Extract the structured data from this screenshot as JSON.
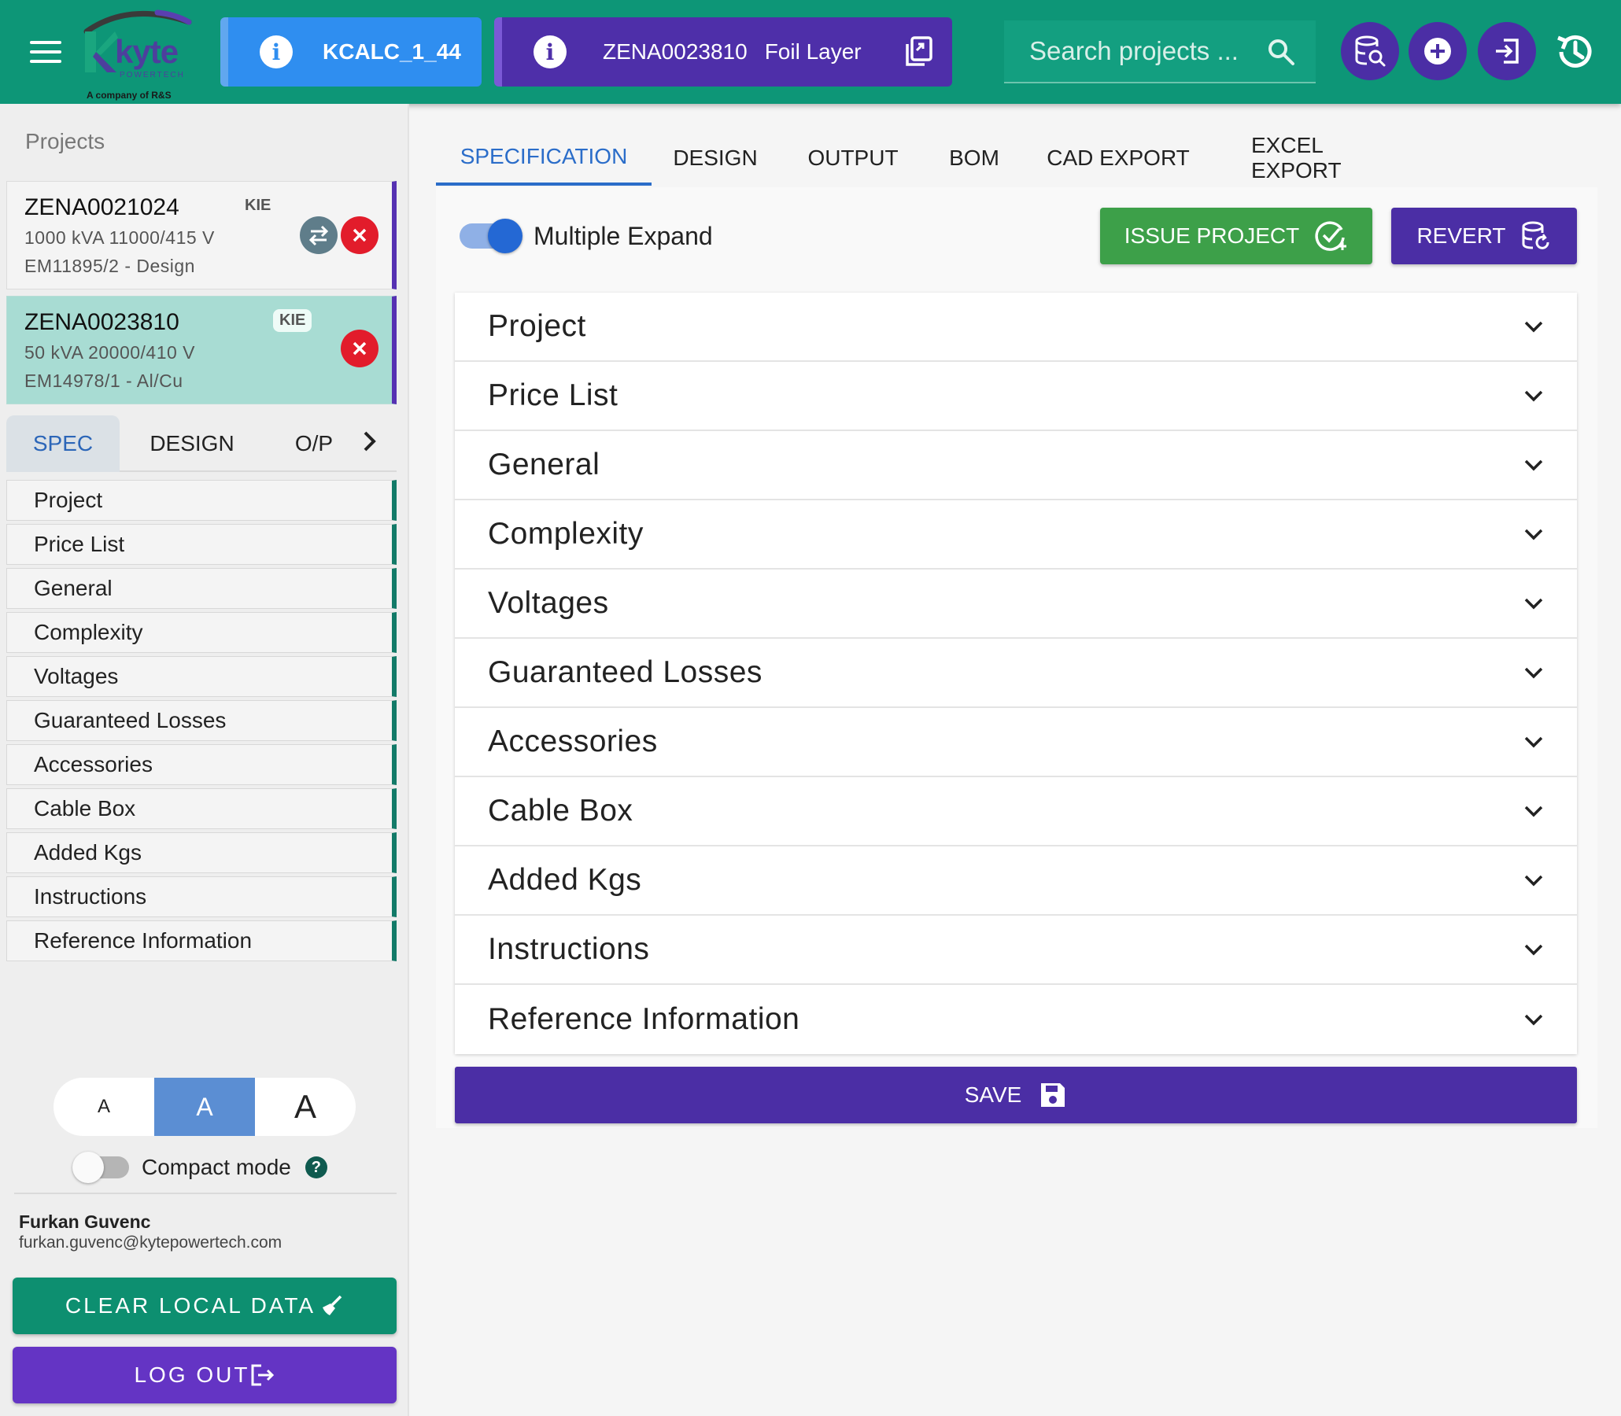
{
  "header": {
    "logo_word": "kyte",
    "logo_sub": "POWERTECH",
    "logo_company": "A company of R&S",
    "kcalc_chip": "KCALC_1_44",
    "project_chip_id": "ZENA0023810",
    "project_chip_layer": "Foil Layer",
    "search_placeholder": "Search projects ...",
    "icons": [
      "menu-icon",
      "info-icon",
      "copy-icon",
      "search-icon",
      "database-search-icon",
      "add-icon",
      "import-icon",
      "history-icon"
    ],
    "colors": {
      "bar": "#0d9677",
      "kcalc": "#2f8ef0",
      "project": "#4e2fa9"
    }
  },
  "sidebar": {
    "heading": "Projects",
    "projects": [
      {
        "id": "ZENA0021024",
        "badge": "KIE",
        "line1": "1000 kVA 11000/415 V",
        "line2": "EM11895/2 - Design"
      },
      {
        "id": "ZENA0023810",
        "badge": "KIE",
        "line1": "50 kVA 20000/410 V",
        "line2": "EM14978/1 - Al/Cu"
      }
    ],
    "tabs": [
      "SPEC",
      "DESIGN",
      "O/P"
    ],
    "items": [
      "Project",
      "Price List",
      "General",
      "Complexity",
      "Voltages",
      "Guaranteed Losses",
      "Accessories",
      "Cable Box",
      "Added Kgs",
      "Instructions",
      "Reference Information"
    ],
    "font_sizes": [
      "A",
      "A",
      "A"
    ],
    "compact_label": "Compact mode",
    "help": "?",
    "user_name": "Furkan Guvenc",
    "user_email": "furkan.guvenc@kytepowertech.com",
    "clear_label": "CLEAR LOCAL DATA",
    "logout_label": "LOG OUT"
  },
  "main": {
    "tabs": [
      "SPECIFICATION",
      "DESIGN",
      "OUTPUT",
      "BOM",
      "CAD EXPORT",
      "EXCEL EXPORT"
    ],
    "multi_expand_label": "Multiple Expand",
    "issue_label": "ISSUE PROJECT",
    "revert_label": "REVERT",
    "sections": [
      "Project",
      "Price List",
      "General",
      "Complexity",
      "Voltages",
      "Guaranteed Losses",
      "Accessories",
      "Cable Box",
      "Added Kgs",
      "Instructions",
      "Reference Information"
    ],
    "save_label": "SAVE"
  }
}
